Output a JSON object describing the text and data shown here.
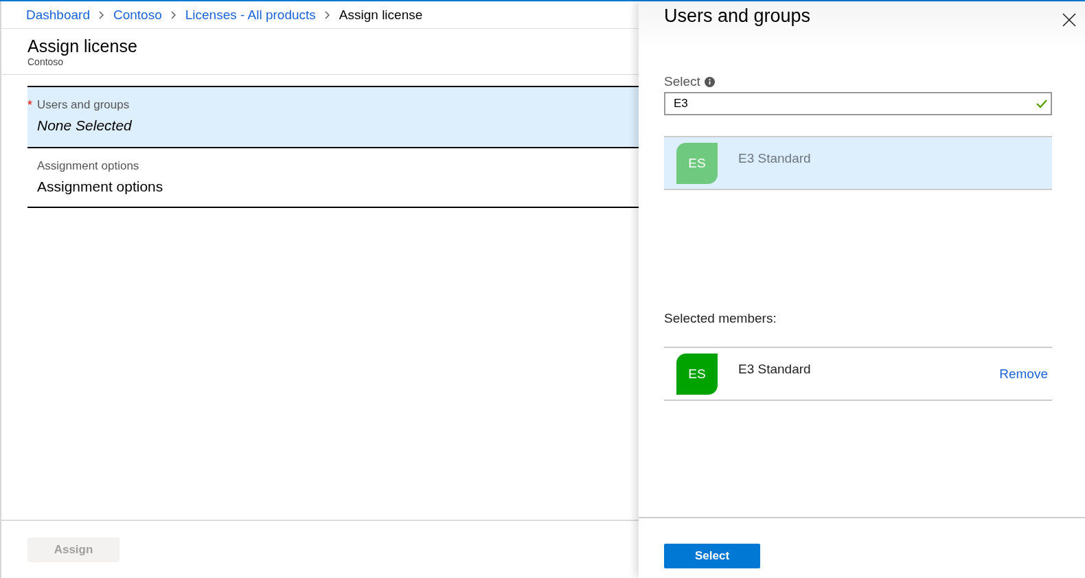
{
  "breadcrumb": [
    {
      "label": "Dashboard",
      "current": false
    },
    {
      "label": "Contoso",
      "current": false
    },
    {
      "label": "Licenses - All products",
      "current": false
    },
    {
      "label": "Assign license",
      "current": true
    }
  ],
  "blade": {
    "title": "Assign license",
    "subtitle": "Contoso",
    "fields": [
      {
        "label": "Users and groups",
        "required_mark": "*",
        "value": "None Selected",
        "empty": true,
        "selected": true
      },
      {
        "label": "Assignment options",
        "value": "Assignment options",
        "empty": false,
        "selected": false
      }
    ],
    "assign_button": {
      "label": "Assign",
      "disabled": true
    }
  },
  "panel": {
    "title": "Users and groups",
    "select_label": "Select",
    "search_value": "E3",
    "valid": true,
    "results": [
      {
        "initials": "ES",
        "name": "E3 Standard",
        "selected": true
      }
    ],
    "members_label": "Selected members:",
    "members": [
      {
        "initials": "ES",
        "name": "E3 Standard",
        "action": "Remove"
      }
    ],
    "select_button": {
      "label": "Select",
      "disabled": false
    }
  }
}
